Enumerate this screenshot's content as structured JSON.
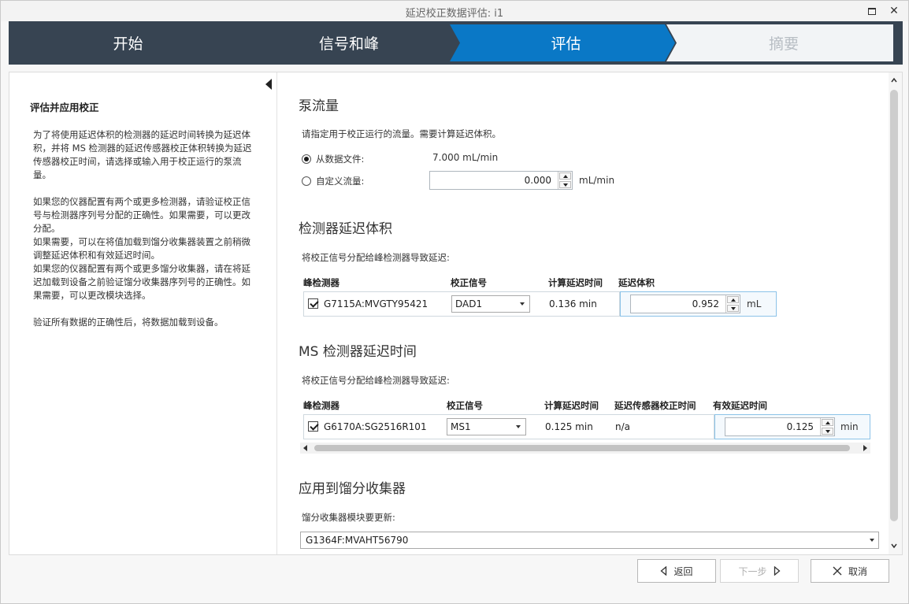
{
  "window": {
    "title": "延迟校正数据评估: i1"
  },
  "steps": [
    {
      "label": "开始"
    },
    {
      "label": "信号和峰"
    },
    {
      "label": "评估"
    },
    {
      "label": "摘要"
    }
  ],
  "colors": {
    "step_dark": "#374452",
    "step_active": "#0a78c6",
    "step_future": "#f2f4f6"
  },
  "left_panel": {
    "title": "评估并应用校正",
    "paragraphs": [
      "为了将使用延迟体积的检测器的延迟时间转换为延迟体积，并将 MS 检测器的延迟传感器校正体积转换为延迟传感器校正时间，请选择或输入用于校正运行的泵流量。",
      "如果您的仪器配置有两个或更多检测器，请验证校正信号与检测器序列号分配的正确性。如果需要，可以更改分配。",
      "如果需要，可以在将值加载到馏分收集器装置之前稍微调整延迟体积和有效延迟时间。",
      "如果您的仪器配置有两个或更多馏分收集器，请在将延迟加载到设备之前验证馏分收集器序列号的正确性。如果需要，可以更改模块选择。",
      "验证所有数据的正确性后，将数据加载到设备。"
    ]
  },
  "pump_flow": {
    "title": "泵流量",
    "hint": "请指定用于校正运行的流量。需要计算延迟体积。",
    "from_file_label": "从数据文件:",
    "from_file_value": "7.000 mL/min",
    "custom_label": "自定义流量:",
    "custom_value": "0.000",
    "custom_unit": "mL/min"
  },
  "detector_delay": {
    "title": "检测器延迟体积",
    "hint": "将校正信号分配给峰检测器导致延迟:",
    "headers": {
      "detector": "峰检测器",
      "signal": "校正信号",
      "calc_time": "计算延迟时间",
      "volume": "延迟体积"
    },
    "row": {
      "detector": "G7115A:MVGTY95421",
      "signal": "DAD1",
      "calc_time": "0.136 min",
      "volume": "0.952",
      "unit": "mL"
    }
  },
  "ms_delay": {
    "title": "MS 检测器延迟时间",
    "hint": "将校正信号分配给峰检测器导致延迟:",
    "headers": {
      "detector": "峰检测器",
      "signal": "校正信号",
      "calc_time": "计算延迟时间",
      "sensor_time": "延迟传感器校正时间",
      "effective": "有效延迟时间"
    },
    "row": {
      "detector": "G6170A:SG2516R101",
      "signal": "MS1",
      "calc_time": "0.125 min",
      "sensor_time": "n/a",
      "effective": "0.125",
      "unit": "min"
    }
  },
  "fraction": {
    "title": "应用到馏分收集器",
    "hint": "馏分收集器模块要更新:",
    "module": "G1364F:MVAHT56790"
  },
  "footer": {
    "back": "返回",
    "next": "下一步",
    "cancel": "取消"
  }
}
